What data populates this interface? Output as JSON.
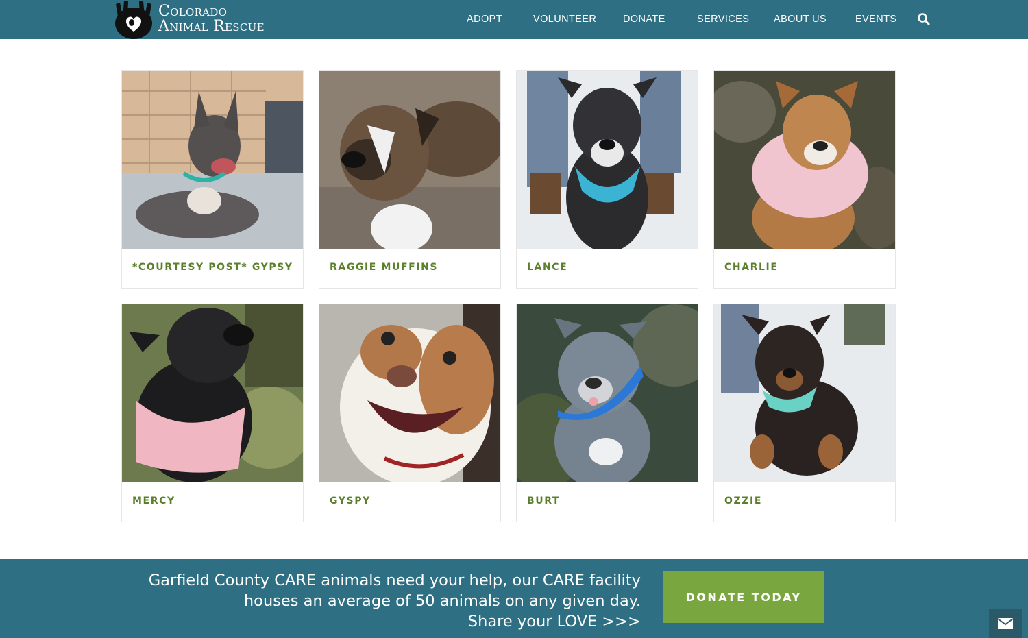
{
  "header": {
    "logo_line1": "Colorado",
    "logo_line2": "Animal Rescue",
    "nav": [
      "ADOPT",
      "VOLUNTEER",
      "DONATE",
      "SERVICES",
      "ABOUT US",
      "EVENTS"
    ],
    "search_icon": "search-icon",
    "bg_color": "#2e6f83"
  },
  "pets": [
    {
      "name": "*COURTESY POST* GYPSY"
    },
    {
      "name": "RAGGIE MUFFINS"
    },
    {
      "name": "LANCE"
    },
    {
      "name": "CHARLIE"
    },
    {
      "name": "MERCY"
    },
    {
      "name": "GYSPY"
    },
    {
      "name": "BURT"
    },
    {
      "name": "OZZIE"
    }
  ],
  "banner": {
    "line1": "Garfield County CARE animals need your help, our CARE facility",
    "line2": "houses an average of 50 animals on any given day.",
    "line3": "Share your LOVE >>>",
    "donate_label": "DONATE TODAY",
    "button_color": "#7aa63f"
  },
  "mail_icon": "envelope-icon",
  "colors": {
    "accent": "#2e6f83",
    "pet_name": "#5b7f2b"
  }
}
